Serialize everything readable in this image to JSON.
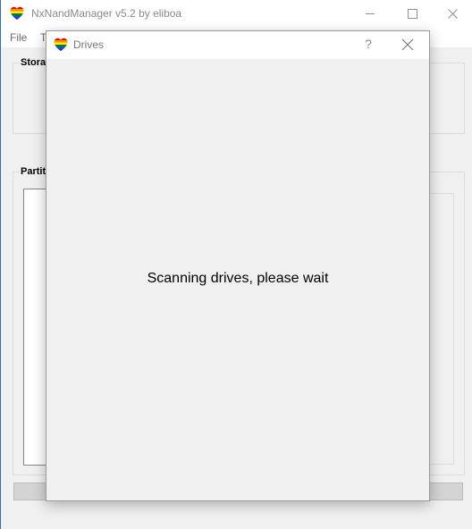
{
  "app": {
    "title": "NxNandManager v5.2 by eliboa",
    "icon": "heart-icon"
  },
  "menu": {
    "items": [
      {
        "label": "File"
      },
      {
        "label": "T"
      }
    ]
  },
  "main": {
    "storage_group_label": "Stora",
    "partitions_group_label": "Partit"
  },
  "dialog": {
    "title": "Drives",
    "help_label": "?",
    "message": "Scanning drives, please wait",
    "icon": "heart-icon"
  },
  "colors": {
    "window_bg": "#f0f0f0",
    "titlebar_bg": "#ffffff",
    "heart_red": "#e40303",
    "heart_orange": "#ff8c00",
    "heart_yellow": "#ffed00",
    "heart_green": "#008026",
    "heart_blue": "#004dff",
    "heart_purple": "#750787"
  }
}
